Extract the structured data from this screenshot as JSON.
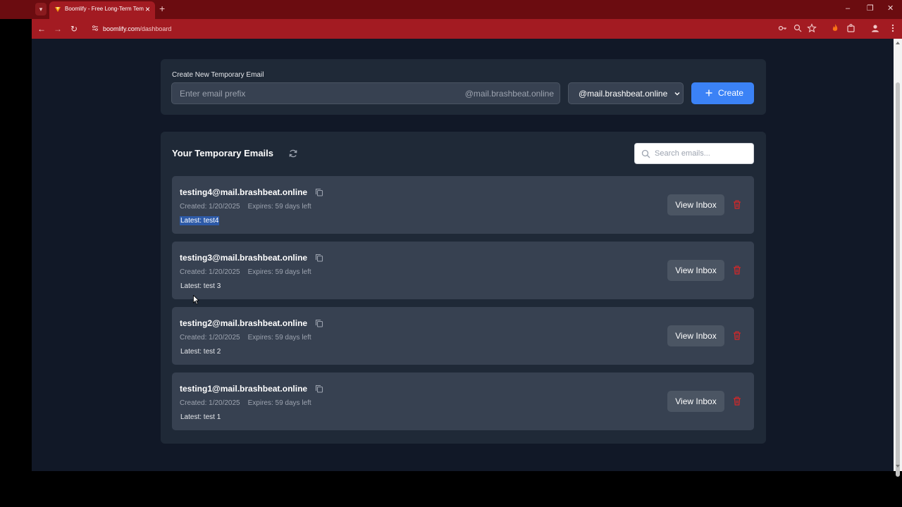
{
  "browser": {
    "tab_title": "Boomlify - Free Long-Term Temp",
    "tab_close": "×",
    "new_tab": "+",
    "url_host": "boomlify.com",
    "url_path": "/dashboard",
    "window_controls": {
      "minimize": "–",
      "restore": "❐",
      "close": "✕"
    },
    "nav": {
      "back": "←",
      "forward": "→",
      "reload": "↻"
    },
    "accent": "#a31b22"
  },
  "create": {
    "label": "Create New Temporary Email",
    "prefix_placeholder": "Enter email prefix",
    "suffix": "@mail.brashbeat.online",
    "domain_selected": "@mail.brashbeat.online",
    "create_label": "Create",
    "button_color": "#3b82f6"
  },
  "emails_section": {
    "title": "Your Temporary Emails",
    "search_placeholder": "Search emails...",
    "view_inbox_label": "View Inbox",
    "items": [
      {
        "address": "testing4@mail.brashbeat.online",
        "created": "Created: 1/20/2025",
        "expires": "Expires: 59 days left",
        "latest": "Latest: test4"
      },
      {
        "address": "testing3@mail.brashbeat.online",
        "created": "Created: 1/20/2025",
        "expires": "Expires: 59 days left",
        "latest": "Latest: test 3"
      },
      {
        "address": "testing2@mail.brashbeat.online",
        "created": "Created: 1/20/2025",
        "expires": "Expires: 59 days left",
        "latest": "Latest: test 2"
      },
      {
        "address": "testing1@mail.brashbeat.online",
        "created": "Created: 1/20/2025",
        "expires": "Expires: 59 days left",
        "latest": "Latest: test 1"
      }
    ]
  },
  "icons": {
    "tab_favicon": "boomlify-logo-icon",
    "copy": "copy-icon",
    "trash": "trash-icon",
    "refresh": "refresh-icon",
    "search": "search-icon",
    "plus": "plus-icon"
  }
}
